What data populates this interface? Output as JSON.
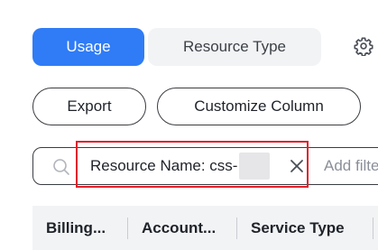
{
  "tabs": {
    "usage_label": "Usage",
    "resource_type_label": "Resource Type"
  },
  "settings": {
    "icon": "gear-icon"
  },
  "toolbar": {
    "export_label": "Export",
    "customize_label": "Customize Column"
  },
  "search": {
    "icon": "search-icon",
    "tag_label": "Resource Name: css-",
    "placeholder": "Add filter"
  },
  "table": {
    "columns": [
      "Billing...",
      "Account...",
      "Service Type"
    ]
  },
  "colors": {
    "accent": "#2f7cf6",
    "highlight": "#e0202a",
    "header_bg": "#f2f3f5"
  }
}
